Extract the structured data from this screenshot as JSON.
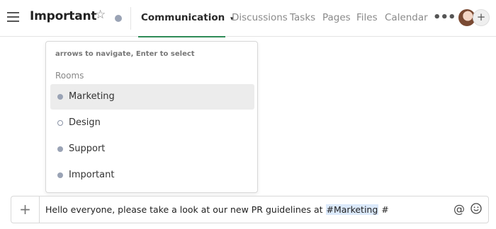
{
  "header": {
    "room_title": "Important",
    "tabs": [
      {
        "label": "Communication",
        "active": true
      },
      {
        "label": "Discussions"
      },
      {
        "label": "Tasks"
      },
      {
        "label": "Pages"
      },
      {
        "label": "Files"
      },
      {
        "label": "Calendar"
      }
    ],
    "active_tab_chevron": "▾",
    "more_icon": "•••",
    "add_member_icon": "+"
  },
  "dropdown": {
    "hint": "arrows to navigate, Enter to select",
    "section_label": "Rooms",
    "items": [
      {
        "label": "Marketing",
        "selected": true,
        "dot": "filled"
      },
      {
        "label": "Design",
        "selected": false,
        "dot": "hollow"
      },
      {
        "label": "Support",
        "selected": false,
        "dot": "filled"
      },
      {
        "label": "Important",
        "selected": false,
        "dot": "filled"
      }
    ]
  },
  "composer": {
    "text_before": "Hello everyone, please take a look at our new PR guidelines at ",
    "tag": "#Marketing",
    "text_after": " #",
    "add_icon": "+",
    "at_icon": "@"
  },
  "colors": {
    "accent_underline": "#2e8b57",
    "room_dot": "#9aa3b5",
    "selected_row": "#ececec",
    "tag_highlight": "#dbe9fb"
  }
}
